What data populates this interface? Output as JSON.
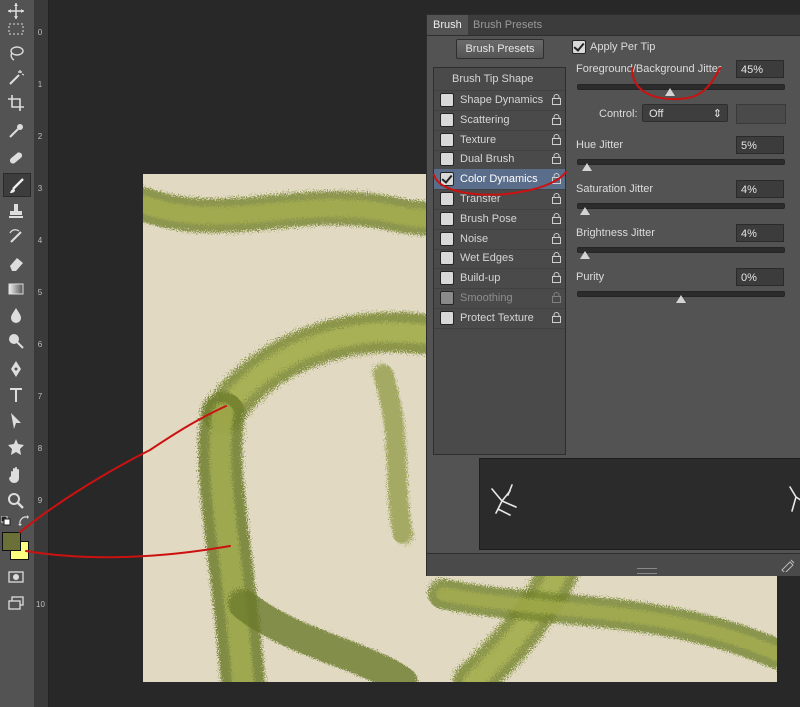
{
  "panel": {
    "tabs": [
      "Brush",
      "Brush Presets"
    ],
    "presets_button": "Brush Presets",
    "apply_per_tip": "Apply Per Tip",
    "brush_tip_shape": "Brush Tip Shape",
    "options": [
      {
        "label": "Shape Dynamics",
        "checked": false,
        "enabled": true
      },
      {
        "label": "Scattering",
        "checked": false,
        "enabled": true
      },
      {
        "label": "Texture",
        "checked": false,
        "enabled": true
      },
      {
        "label": "Dual Brush",
        "checked": false,
        "enabled": true
      },
      {
        "label": "Color Dynamics",
        "checked": true,
        "enabled": true,
        "selected": true
      },
      {
        "label": "Transfer",
        "checked": false,
        "enabled": true
      },
      {
        "label": "Brush Pose",
        "checked": false,
        "enabled": true
      },
      {
        "label": "Noise",
        "checked": false,
        "enabled": true
      },
      {
        "label": "Wet Edges",
        "checked": false,
        "enabled": true
      },
      {
        "label": "Build-up",
        "checked": false,
        "enabled": true
      },
      {
        "label": "Smoothing",
        "checked": false,
        "enabled": false
      },
      {
        "label": "Protect Texture",
        "checked": false,
        "enabled": true
      }
    ],
    "fg_bg_jitter": {
      "label": "Foreground/Background Jitter",
      "value": "45%",
      "level": 0.45
    },
    "control": {
      "label": "Control:",
      "value": "Off"
    },
    "hue_jitter": {
      "label": "Hue Jitter",
      "value": "5%",
      "level": 0.05
    },
    "saturation_jitter": {
      "label": "Saturation Jitter",
      "value": "4%",
      "level": 0.04
    },
    "brightness_jitter": {
      "label": "Brightness Jitter",
      "value": "4%",
      "level": 0.04
    },
    "purity": {
      "label": "Purity",
      "value": "0%",
      "level": 0.5
    }
  },
  "colors": {
    "foreground": "#6b7038",
    "background": "#ffff80",
    "canvas": "#e1d9c1",
    "annotation": "#cc1111",
    "selected_row": "#5a6d8a"
  },
  "ruler_labels": [
    "0",
    "1",
    "2",
    "3",
    "4",
    "5",
    "6",
    "7",
    "8",
    "9",
    "10"
  ],
  "tools": [
    "move-icon",
    "marquee-icon",
    "lasso-icon",
    "magic-wand-icon",
    "crop-icon",
    "eyedropper-icon",
    "healing-icon",
    "brush-icon",
    "stamp-icon",
    "history-brush-icon",
    "eraser-icon",
    "gradient-icon",
    "blur-icon",
    "dodge-icon",
    "pen-icon",
    "type-icon",
    "path-select-icon",
    "shape-icon",
    "hand-icon",
    "zoom-icon"
  ]
}
